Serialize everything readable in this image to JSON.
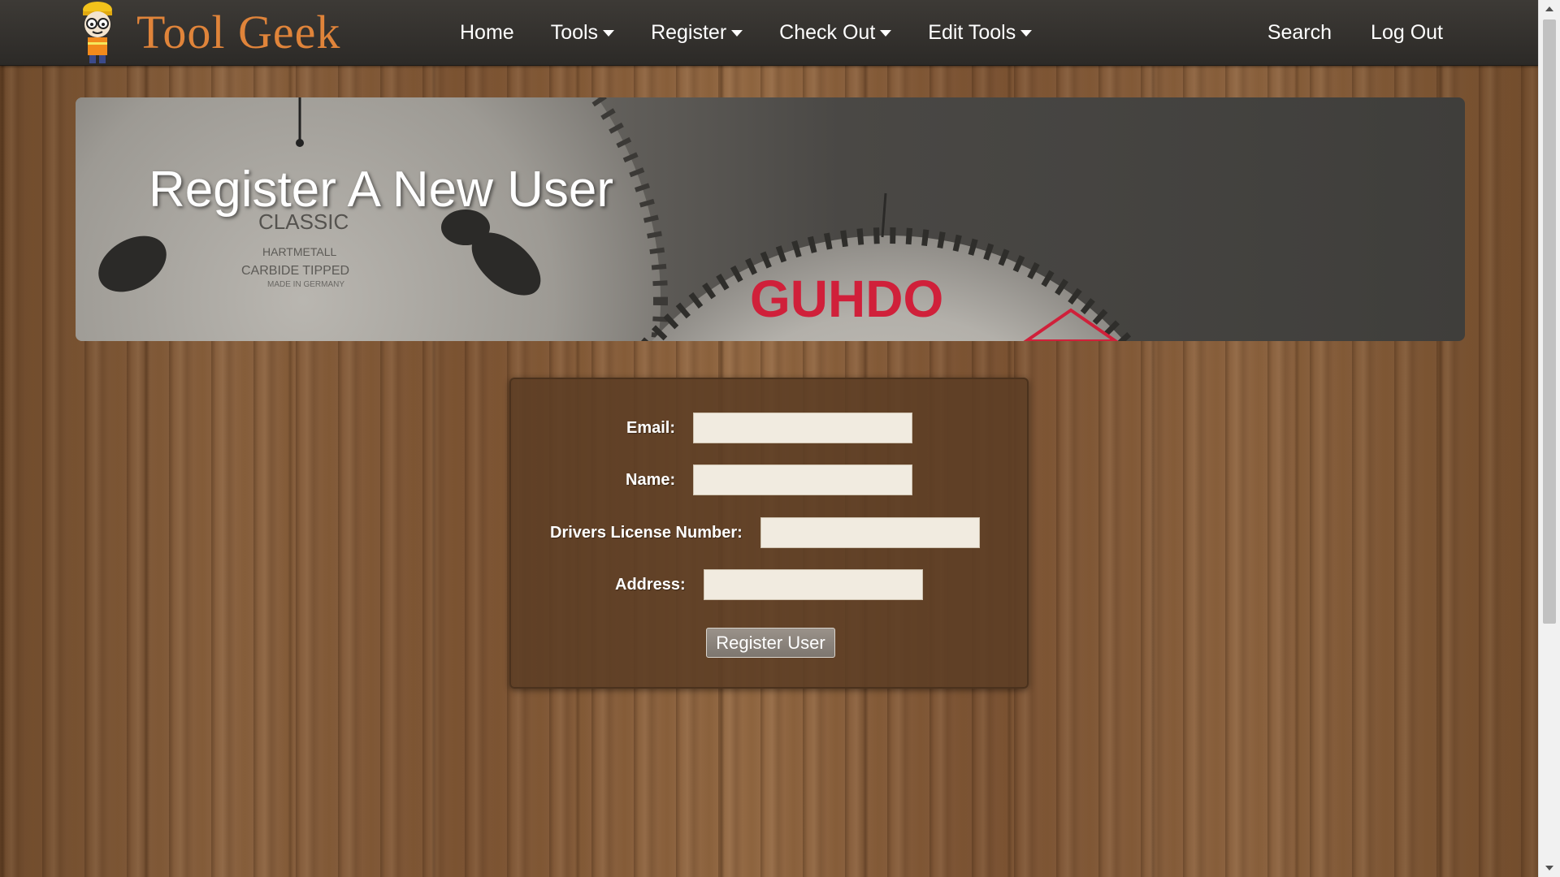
{
  "navbar": {
    "brand": "Tool Geek",
    "logo_icon": "geek-mascot-icon",
    "items": [
      {
        "label": "Home",
        "has_dropdown": false
      },
      {
        "label": "Tools",
        "has_dropdown": true
      },
      {
        "label": "Register",
        "has_dropdown": true
      },
      {
        "label": "Check Out",
        "has_dropdown": true
      },
      {
        "label": "Edit Tools",
        "has_dropdown": true
      }
    ],
    "right_items": [
      {
        "label": "Search"
      },
      {
        "label": "Log Out"
      }
    ]
  },
  "hero": {
    "title": "Register A New User",
    "blade1_text1": "CLASSIC",
    "blade1_text2": "HARTMETALL",
    "blade1_text3": "CARBIDE TIPPED",
    "blade1_text4": "MADE IN GERMANY",
    "blade2_brand": "GUHDO"
  },
  "form": {
    "fields": [
      {
        "label": "Email:",
        "value": "",
        "placeholder": ""
      },
      {
        "label": "Name:",
        "value": "",
        "placeholder": ""
      },
      {
        "label": "Drivers License Number:",
        "value": "",
        "placeholder": ""
      },
      {
        "label": "Address:",
        "value": "",
        "placeholder": ""
      }
    ],
    "submit_label": "Register User"
  },
  "colors": {
    "brand": "#e0843a",
    "navbar_bg": "#353230",
    "panel_bg": "#5c3e24",
    "input_bg": "#f1ebe0",
    "guhdo_red": "#d0203a"
  }
}
